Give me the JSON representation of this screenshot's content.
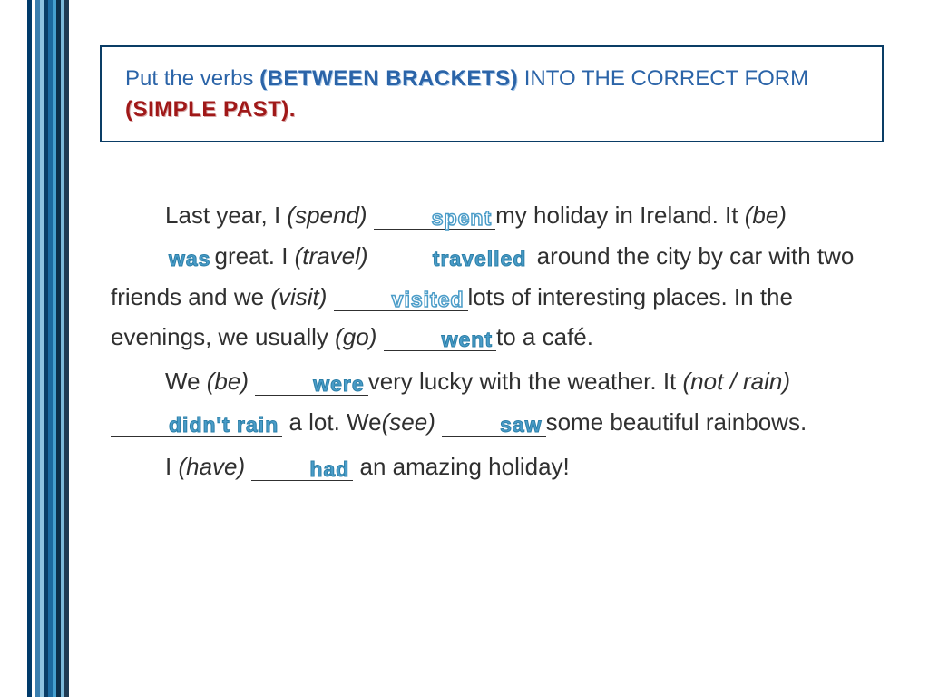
{
  "instruction": {
    "prefix": "Put the verbs ",
    "brackets": "(BETWEEN BRACKETS)",
    "middle": " INTO THE CORRECT FORM ",
    "simple_past": "(SIMPLE PAST)."
  },
  "paragraphs": [
    {
      "segments": [
        {
          "type": "text",
          "value": "Last year, I "
        },
        {
          "type": "hint",
          "value": "(spend)"
        },
        {
          "type": "blank",
          "answer": "spent",
          "style": "outline",
          "width": "med"
        },
        {
          "type": "text",
          "value": "my holiday in Ireland. It "
        },
        {
          "type": "hint",
          "value": "(be)"
        },
        {
          "type": "blank",
          "answer": "was",
          "style": "solid",
          "width": "short"
        },
        {
          "type": "text",
          "value": "great. I "
        },
        {
          "type": "hint",
          "value": "(travel)"
        },
        {
          "type": "blank",
          "answer": "travelled",
          "style": "solid",
          "width": "med"
        },
        {
          "type": "text",
          "value": " around the city by car with two friends and we "
        },
        {
          "type": "hint",
          "value": "(visit)"
        },
        {
          "type": "blank",
          "answer": "visited",
          "style": "outline",
          "width": "med"
        },
        {
          "type": "text",
          "value": "lots of interesting places. In the evenings, we usually "
        },
        {
          "type": "hint",
          "value": "(go)"
        },
        {
          "type": "blank",
          "answer": "went",
          "style": "solid",
          "width": "short"
        },
        {
          "type": "text",
          "value": "to a café."
        }
      ]
    },
    {
      "segments": [
        {
          "type": "text",
          "value": "We "
        },
        {
          "type": "hint",
          "value": "(be)"
        },
        {
          "type": "blank",
          "answer": "were",
          "style": "solid",
          "width": "short"
        },
        {
          "type": "text",
          "value": "very lucky with the weather. It "
        },
        {
          "type": "hint",
          "value": "(not / rain)"
        },
        {
          "type": "blank",
          "answer": "didn't rain",
          "style": "solid",
          "width": "med"
        },
        {
          "type": "text",
          "value": " a lot. We"
        },
        {
          "type": "hint",
          "value": "(see)"
        },
        {
          "type": "blank",
          "answer": "saw",
          "style": "solid",
          "width": "short"
        },
        {
          "type": "text",
          "value": "some beautiful rainbows."
        }
      ]
    },
    {
      "segments": [
        {
          "type": "text",
          "value": "I "
        },
        {
          "type": "hint",
          "value": "(have)"
        },
        {
          "type": "blank",
          "answer": "had",
          "style": "solid",
          "width": "short"
        },
        {
          "type": "text",
          "value": " an amazing holiday!"
        }
      ]
    }
  ]
}
